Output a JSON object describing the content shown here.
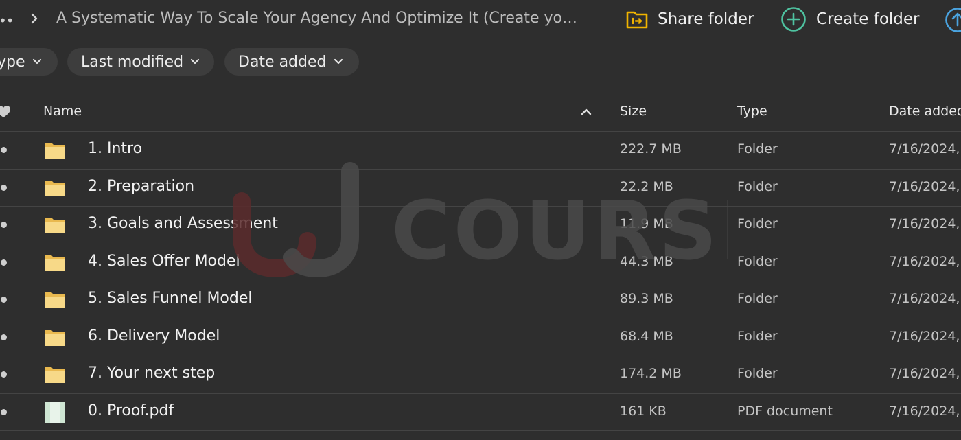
{
  "breadcrumb": {
    "overflow": "••",
    "title": "A Systematic Way To Scale Your Agency And Optimize It (Create your K..."
  },
  "actions": {
    "share_label": "Share folder",
    "create_label": "Create folder"
  },
  "filters": [
    {
      "label": "ype"
    },
    {
      "label": "Last modified"
    },
    {
      "label": "Date added"
    }
  ],
  "table": {
    "columns": {
      "name": "Name",
      "size": "Size",
      "type": "Type",
      "date": "Date added"
    },
    "rows": [
      {
        "name": "1. Intro",
        "size": "222.7 MB",
        "type": "Folder",
        "date": "7/16/2024,",
        "kind": "folder"
      },
      {
        "name": "2. Preparation",
        "size": "22.2 MB",
        "type": "Folder",
        "date": "7/16/2024,",
        "kind": "folder"
      },
      {
        "name": "3. Goals and Assessment",
        "size": "11.9 MB",
        "type": "Folder",
        "date": "7/16/2024,",
        "kind": "folder"
      },
      {
        "name": "4. Sales Offer Model",
        "size": "44.3 MB",
        "type": "Folder",
        "date": "7/16/2024,",
        "kind": "folder"
      },
      {
        "name": "5. Sales Funnel Model",
        "size": "89.3 MB",
        "type": "Folder",
        "date": "7/16/2024,",
        "kind": "folder"
      },
      {
        "name": "6. Delivery Model",
        "size": "68.4 MB",
        "type": "Folder",
        "date": "7/16/2024,",
        "kind": "folder"
      },
      {
        "name": "7. Your next step",
        "size": "174.2 MB",
        "type": "Folder",
        "date": "7/16/2024,",
        "kind": "folder"
      },
      {
        "name": "0. Proof.pdf",
        "size": "161 KB",
        "type": "PDF document",
        "date": "7/16/2024,",
        "kind": "pdf"
      }
    ]
  },
  "watermark": {
    "text": "COURSE"
  },
  "colors": {
    "background": "#2e2e2e",
    "folder": "#f5d27a",
    "share_icon": "#f0b400",
    "create_icon": "#4fc3a1",
    "upload_icon": "#4aa3df",
    "watermark_red": "#8a2f33"
  }
}
